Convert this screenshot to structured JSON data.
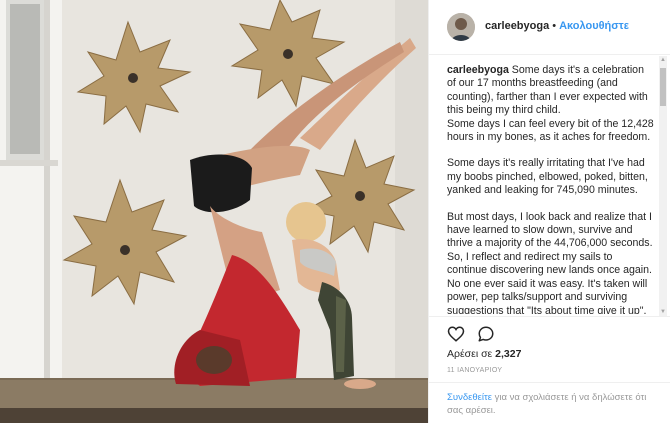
{
  "post": {
    "username": "carleebyoga",
    "separator": "•",
    "follow_label": "Ακολουθήστε",
    "caption_username": "carleebyoga",
    "caption_paragraphs": [
      "Some days it's a celebration of our 17 months breastfeeding (and counting), farther than I ever expected with this being my third child.",
      "Some days I can feel every bit of the 12,428 hours in my bones, as it aches for freedom.",
      "Some days it's really irritating that I've had my boobs pinched, elbowed, poked, bitten, yanked and leaking for 745,090 minutes.",
      "But most days, I look back and realize that I have learned to slow down, survive and thrive a majority of the 44,706,000 seconds. So, I reflect and redirect my sails to continue discovering new lands once again. No one ever said it was easy. It's taken will power, pep talks/support and surviving suggestions that \"Its about time give it up\", that feed on my doubt at times of"
    ],
    "likes_prefix": "Αρέσει σε",
    "likes_count": "2,327",
    "date": "11 ΙΑΝΟΥΑΡΙΟΥ",
    "login_link": "Συνδεθείτε",
    "login_text": " για να σχολιάσετε ή να δηλώσετε ότι σας αρέσει."
  },
  "icons": {
    "like": "heart-outline-icon",
    "comment": "speech-bubble-icon",
    "scroll_up": "triangle-up-icon",
    "scroll_down": "triangle-down-icon"
  },
  "colors": {
    "accent": "#3897f0",
    "text": "#262626",
    "muted": "#999999",
    "divider": "#efefef"
  }
}
